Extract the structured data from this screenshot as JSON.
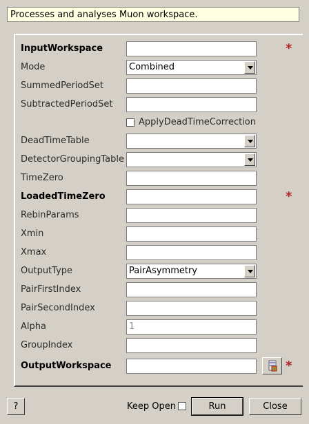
{
  "description": "Processes and analyses Muon workspace.",
  "fields": {
    "input_workspace": {
      "label": "InputWorkspace",
      "value": ""
    },
    "mode": {
      "label": "Mode",
      "value": "Combined"
    },
    "summed_period_set": {
      "label": "SummedPeriodSet",
      "value": ""
    },
    "subtracted_period_set": {
      "label": "SubtractedPeriodSet",
      "value": ""
    },
    "apply_dead_time": {
      "label": "ApplyDeadTimeCorrection",
      "checked": false
    },
    "dead_time_table": {
      "label": "DeadTimeTable",
      "value": ""
    },
    "detector_grouping_table": {
      "label": "DetectorGroupingTable",
      "value": ""
    },
    "time_zero": {
      "label": "TimeZero",
      "value": ""
    },
    "loaded_time_zero": {
      "label": "LoadedTimeZero",
      "value": ""
    },
    "rebin_params": {
      "label": "RebinParams",
      "value": ""
    },
    "xmin": {
      "label": "Xmin",
      "value": ""
    },
    "xmax": {
      "label": "Xmax",
      "value": ""
    },
    "output_type": {
      "label": "OutputType",
      "value": "PairAsymmetry"
    },
    "pair_first_index": {
      "label": "PairFirstIndex",
      "value": ""
    },
    "pair_second_index": {
      "label": "PairSecondIndex",
      "value": ""
    },
    "alpha": {
      "label": "Alpha",
      "value": "1"
    },
    "group_index": {
      "label": "GroupIndex",
      "value": ""
    },
    "output_workspace": {
      "label": "OutputWorkspace",
      "value": ""
    }
  },
  "required_marker": "*",
  "footer": {
    "help_label": "?",
    "keep_open_label": "Keep Open",
    "keep_open_checked": false,
    "run_label": "Run",
    "close_label": "Close"
  },
  "icons": {
    "browse": "workspace-browse-icon",
    "required": "required-star-icon"
  },
  "colors": {
    "background": "#d4d0c8",
    "description_bg": "#ffffe1",
    "required_star": "#b22222"
  }
}
